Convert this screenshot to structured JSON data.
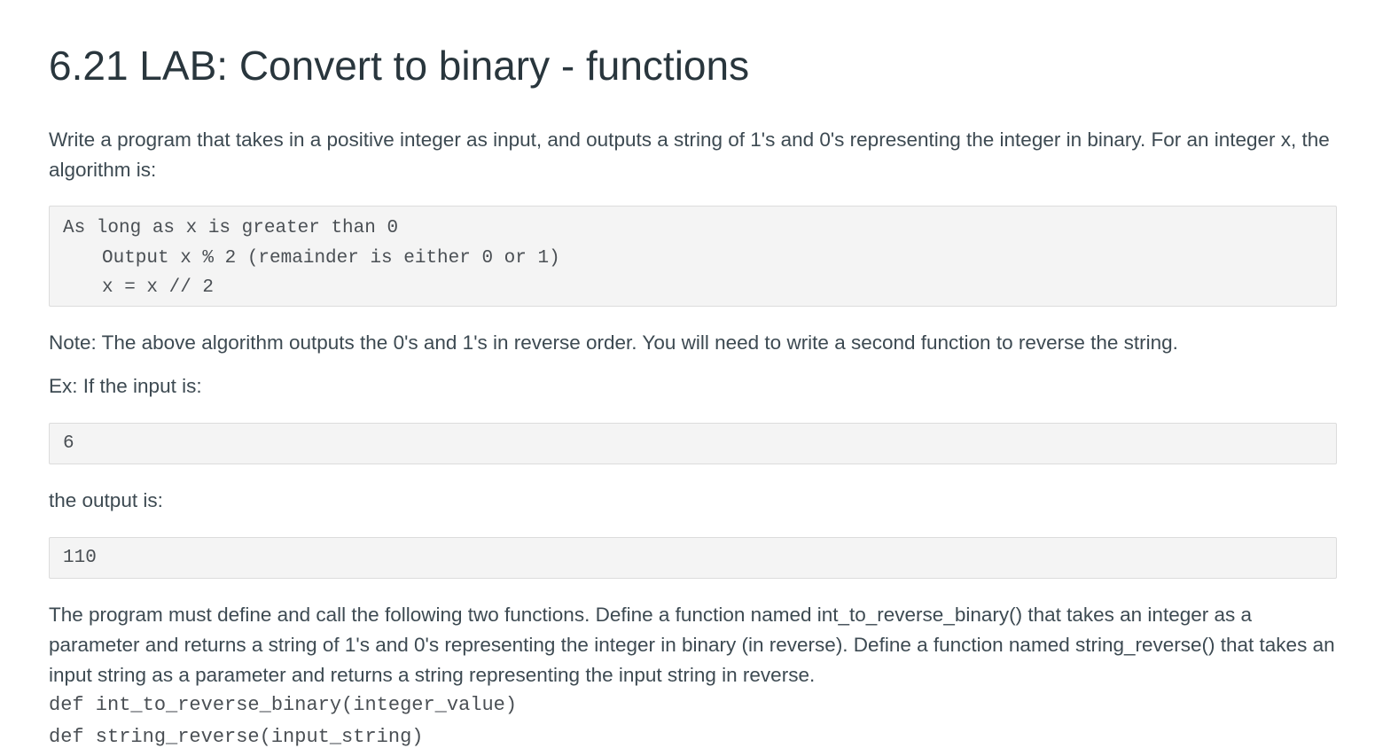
{
  "title": "6.21 LAB: Convert to binary - functions",
  "intro": "Write a program that takes in a positive integer as input, and outputs a string of 1's and 0's representing the integer in binary. For an integer x, the algorithm is:",
  "algorithm": {
    "lines": [
      "As long as x is greater than 0",
      "Output x % 2 (remainder is either 0 or 1)",
      "x = x // 2"
    ]
  },
  "note": "Note: The above algorithm outputs the 0's and 1's in reverse order. You will need to write a second function to reverse the string.",
  "example_input_label": "Ex: If the input is:",
  "example_input": "6",
  "example_output_label": "the output is:",
  "example_output": "110",
  "define_text": "The program must define and call the following two functions. Define a function named int_to_reverse_binary() that takes an integer as a parameter and returns a string of 1's and 0's representing the integer in binary (in reverse). Define a function named string_reverse() that takes an input string as a parameter and returns a string representing the input string in reverse.",
  "signatures": [
    "def int_to_reverse_binary(integer_value)",
    "def string_reverse(input_string)"
  ]
}
